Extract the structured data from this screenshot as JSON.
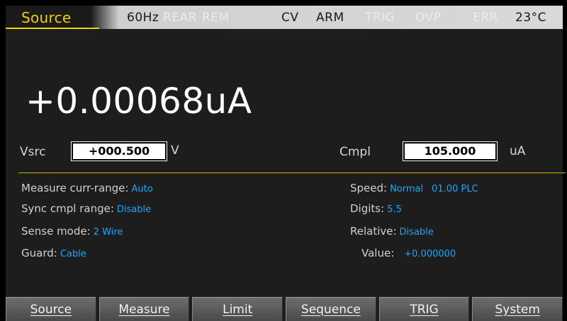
{
  "status_bar": {
    "mode": "Source",
    "items": [
      {
        "label": "60Hz",
        "active": true
      },
      {
        "label": "REAR",
        "active": false
      },
      {
        "label": "REM",
        "active": false
      },
      {
        "label": "CV",
        "active": true
      },
      {
        "label": "ARM",
        "active": true
      },
      {
        "label": "TRIG",
        "active": false
      },
      {
        "label": "OVP",
        "active": false
      },
      {
        "label": "ERR",
        "active": false
      },
      {
        "label": "23°C",
        "active": true
      }
    ]
  },
  "reading": {
    "value": "+0.00068uA"
  },
  "vsrc": {
    "label": "Vsrc",
    "value": "+000.500",
    "unit": "V"
  },
  "cmpl": {
    "label": "Cmpl",
    "value": "105.000",
    "unit": "uA"
  },
  "settings": {
    "measure_range": {
      "label": "Measure curr-range:",
      "value": "Auto"
    },
    "sync_cmpl": {
      "label": "Sync cmpl range:",
      "value": "Disable"
    },
    "sense_mode": {
      "label": "Sense mode:",
      "value": "2 Wire"
    },
    "guard": {
      "label": "Guard:",
      "value": "Cable"
    },
    "speed": {
      "label": "Speed:",
      "value": "Normal",
      "value2": "01.00 PLC"
    },
    "digits": {
      "label": "Digits:",
      "value": "5.5"
    },
    "relative": {
      "label": "Relative:",
      "value": "Disable"
    },
    "rel_value": {
      "label": "Value:",
      "value": "+0.000000"
    }
  },
  "softkeys": [
    "Source",
    "Measure",
    "Limit",
    "Sequence",
    "TRIG",
    "System"
  ],
  "colors": {
    "mode_accent": "#f0d000",
    "value_blue": "#18a6ff",
    "background": "#1d1d1d"
  }
}
